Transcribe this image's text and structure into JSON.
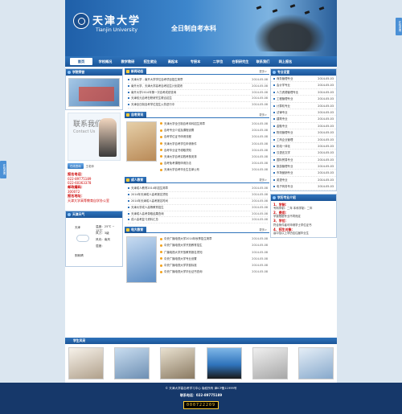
{
  "header": {
    "uni_cn": "天津大学",
    "uni_en": "Tianjin University",
    "slogan": "全日制自考本科"
  },
  "nav": [
    "首页",
    "学校概况",
    "教学教研",
    "招生就业",
    "高起本",
    "专接本",
    "二学位",
    "在职研究生",
    "联系我们",
    "网上报名"
  ],
  "left": {
    "photo_title": "学院荣誉",
    "contact_cn": "联系我们",
    "contact_en": "Contact Us",
    "consult_btn": "在线咨询",
    "consult_name": "王老师",
    "phone_label": "报名电话：",
    "phones": [
      "022-89775189",
      "022-60363378"
    ],
    "email_label": "邮政编码：",
    "postcode": "300072",
    "addr_label": "报名地址：",
    "address": "天津大学高等教育自学办公室",
    "weather_title": "天津天气",
    "weather_city": "天津",
    "weather_rows": [
      {
        "k": "温度：",
        "v": "25℃ ~ 15℃"
      },
      {
        "k": "风力：",
        "v": "3级"
      },
      {
        "k": "风向：",
        "v": "南风"
      },
      {
        "k": "湿度：",
        "v": ""
      }
    ],
    "weather_desc": "阴转晴"
  },
  "news": {
    "title": "新闻动态",
    "more": "更多>",
    "items": [
      {
        "t": "天津大学 - 南开大学学位自考项目招生简章",
        "d": "2014-05-08"
      },
      {
        "t": "南开大学、天津大学高考自考招生计划发布",
        "d": "2014-05-08"
      },
      {
        "t": "南开大学2014年第一次自考成绩查询",
        "d": "2014-05-08"
      },
      {
        "t": "天津双元自考在职研究生联合招生",
        "d": "2014-05-08"
      },
      {
        "t": "天津全日制自考学位招生火热进行中",
        "d": "2014-05-08"
      }
    ]
  },
  "exam": {
    "title": "自考资讯",
    "more": "更多>",
    "items": [
      {
        "t": "天津大学全日制自考本科招生简章",
        "d": "2014-05-08"
      },
      {
        "t": "自考专业介绍及课程设置",
        "d": "2014-05-08"
      },
      {
        "t": "自考学位证书申请流程",
        "d": "2014-05-08"
      },
      {
        "t": "天津大学自考学位申请条件",
        "d": "2014-05-08"
      },
      {
        "t": "自考毕业证书领取须知",
        "d": "2014-05-08"
      },
      {
        "t": "天津大学自考实践考核安排",
        "d": "2014-05-08"
      },
      {
        "t": "自考免考课程申请办法",
        "d": "2014-05-08"
      },
      {
        "t": "天津大学自考毕业生名单公布",
        "d": "2014-05-08"
      }
    ]
  },
  "adult": {
    "title": "成人教育",
    "more": "更多>",
    "items": [
      {
        "t": "天津成人教育2014年招生简章",
        "d": "2014-05-08"
      },
      {
        "t": "2014年天津成人高考报名须知",
        "d": "2014-05-08"
      },
      {
        "t": "2014年天津成人高考报名时间",
        "d": "2014-05-08"
      },
      {
        "t": "天津大学成人高等教育招生",
        "d": "2014-05-08"
      },
      {
        "t": "天津成人高考录取结果查询",
        "d": "2014-05-08"
      },
      {
        "t": "成人高考复习资料汇总",
        "d": "2014-05-08"
      }
    ]
  },
  "tv": {
    "title": "电大教育",
    "more": "更多>",
    "items": [
      {
        "t": "中央广播电视大学2014年秋季招生简章",
        "d": "2014-05-08"
      },
      {
        "t": "中央广播电视大学开放教育招生",
        "d": "2014-05-08"
      },
      {
        "t": "广播电视大学开放教育报名须知",
        "d": "2014-05-08"
      },
      {
        "t": "中央广播电视大学专业设置",
        "d": "2014-05-08"
      },
      {
        "t": "中央广播电视大学学费标准",
        "d": "2014-05-08"
      },
      {
        "t": "中央广播电视大学毕业证书查询",
        "d": "2014-05-08"
      }
    ]
  },
  "majors": {
    "title": "专业设置",
    "items": [
      {
        "t": "商务管理专业",
        "d": "2014-05-03"
      },
      {
        "t": "会计学专业",
        "d": "2014-05-03"
      },
      {
        "t": "人力资源管理专业",
        "d": "2014-05-03"
      },
      {
        "t": "工程管理专业",
        "d": "2014-05-03"
      },
      {
        "t": "计算机专业",
        "d": "2014-05-03"
      },
      {
        "t": "法律专业",
        "d": "2014-05-03"
      },
      {
        "t": "建筑专业",
        "d": "2014-05-03"
      },
      {
        "t": "金融专业",
        "d": "2014-05-03"
      },
      {
        "t": "物流管理专业",
        "d": "2014-05-03"
      },
      {
        "t": "工商企业管理",
        "d": "2014-05-03"
      },
      {
        "t": "机电一体化",
        "d": "2014-05-03"
      },
      {
        "t": "汉语言文学",
        "d": "2014-05-03"
      },
      {
        "t": "国际贸易专业",
        "d": "2014-05-03"
      },
      {
        "t": "旅游管理专业",
        "d": "2014-05-03"
      },
      {
        "t": "市场营销专业",
        "d": "2014-05-03"
      },
      {
        "t": "英语专业",
        "d": "2014-05-03"
      },
      {
        "t": "电子商务专业",
        "d": "2014-05-03"
      }
    ]
  },
  "intro": {
    "title": "学历专业介绍",
    "h1": "1、学制：",
    "t1": "专科学制：二年 本科学制：二年",
    "h2": "2、费用：",
    "t2": "学费根据专业不同而定",
    "h3": "3、学位：",
    "t3": "符合条件者可申请学士学位证书",
    "h4": "4、招生对象：",
    "t4": "高中及以上学历应往届毕业生"
  },
  "gallery_title": "学生风采",
  "footer": {
    "l1": "© 天津大学高自考学习中心  版权所有  津ICP备11999号",
    "l2": "联系电话：022-89775189",
    "counter": "000722209"
  },
  "floats": {
    "left": "在线咨询",
    "right": "在线咨询"
  }
}
